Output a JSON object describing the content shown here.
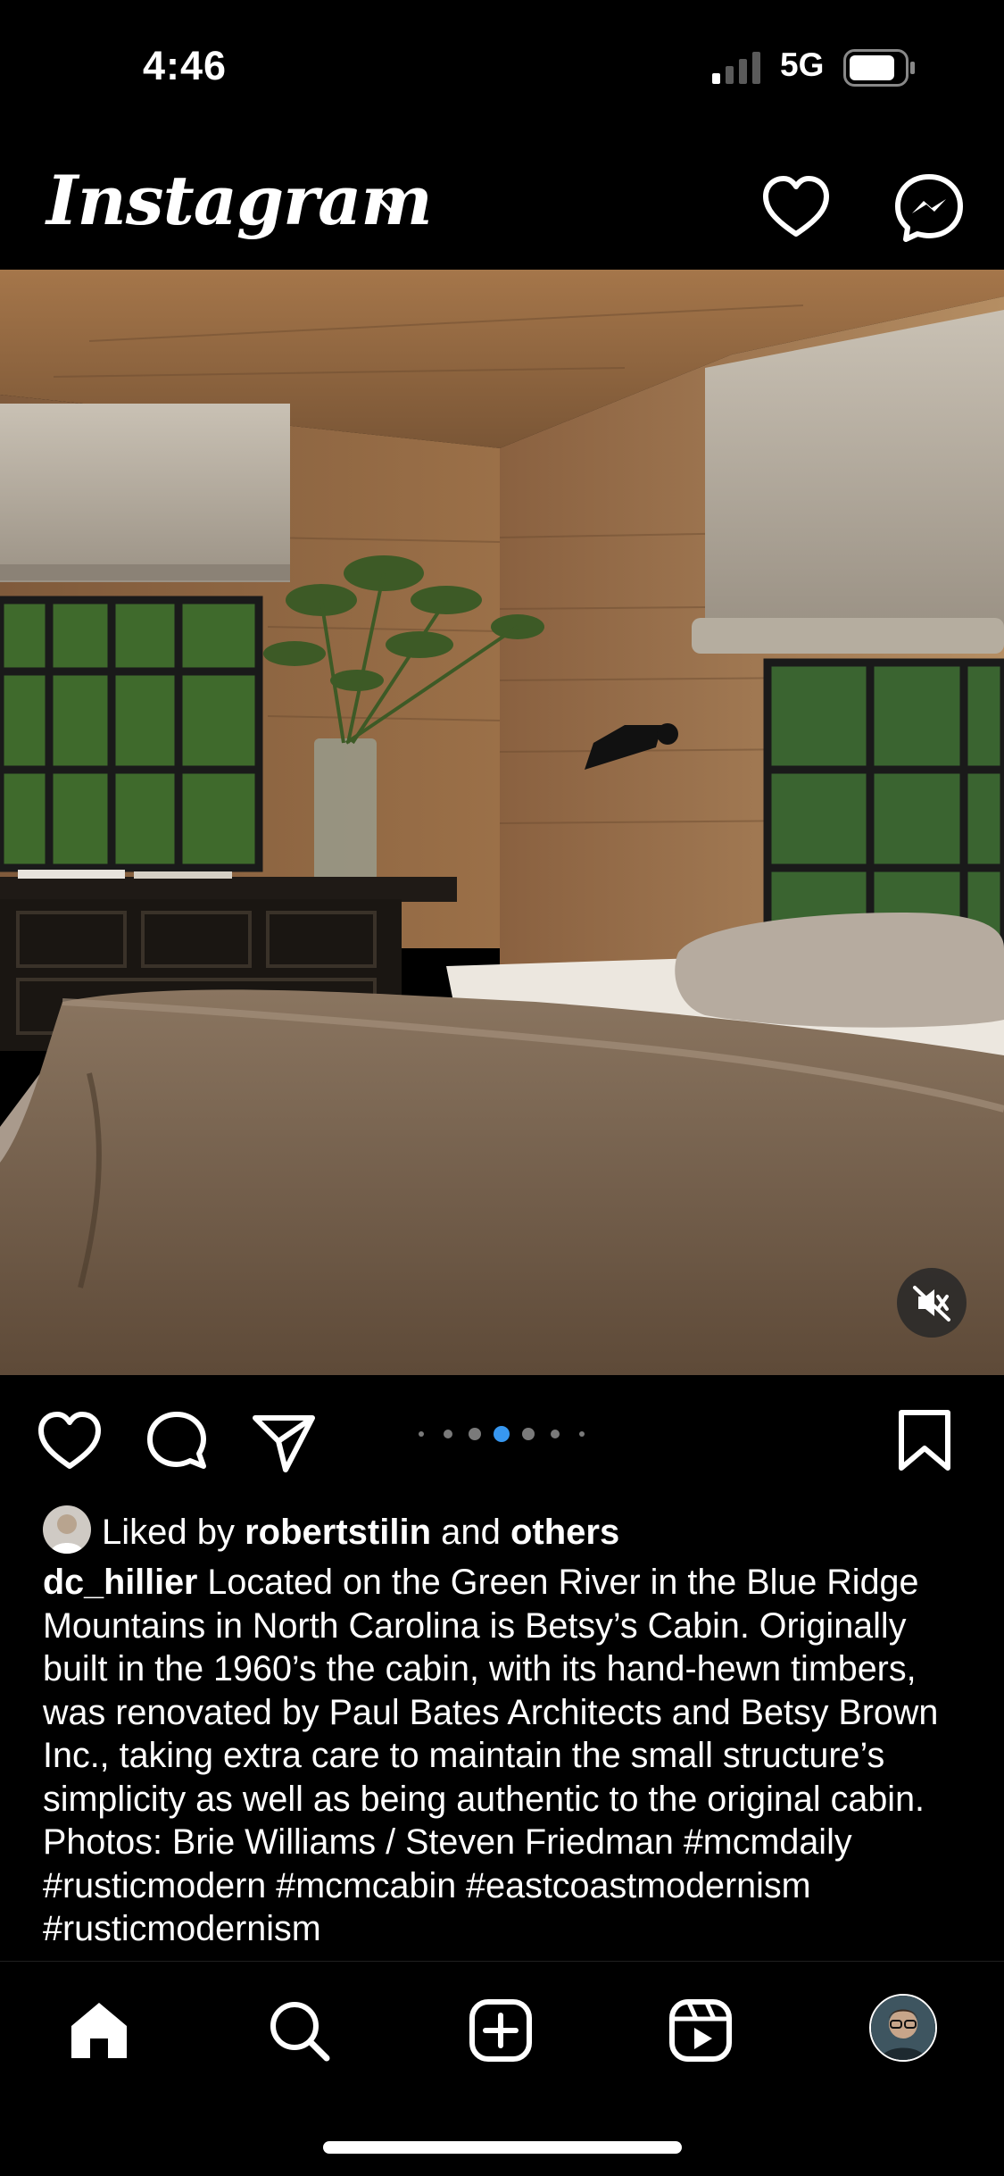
{
  "status_bar": {
    "time": "4:46",
    "network": "5G"
  },
  "header": {
    "logo_text": "Instagram"
  },
  "post": {
    "carousel": {
      "total_dots": 7,
      "active_index": 3
    },
    "likes": {
      "prefix": "Liked by ",
      "user": "robertstilin",
      "middle": " and ",
      "others": "others"
    },
    "caption": {
      "username": "dc_hillier",
      "text": " Located on the Green River in the Blue Ridge Mountains in North Carolina is Betsy’s Cabin. Originally built in the 1960’s the cabin, with its hand-hewn timbers, was renovated by Paul Bates Architects and Betsy Brown Inc., taking extra care to maintain the small structure’s simplicity as well as being authentic to the original cabin. Photos: Brie Williams / Steven Friedman #mcmdaily #rusticmodern #mcmcabin #eastcoastmodernism #rusticmodernism"
    }
  },
  "icons": {
    "header": [
      "chevron-down-icon",
      "heart-icon",
      "messenger-icon"
    ],
    "actions": [
      "like-icon",
      "comment-icon",
      "share-icon",
      "save-icon"
    ],
    "photo": [
      "mute-icon"
    ],
    "nav": [
      "home-icon",
      "search-icon",
      "create-icon",
      "reels-icon",
      "profile-avatar"
    ]
  },
  "colors": {
    "background": "#000000",
    "text": "#ffffff",
    "active_dot": "#3797f0",
    "inactive_dot": "#7a7a7a"
  }
}
